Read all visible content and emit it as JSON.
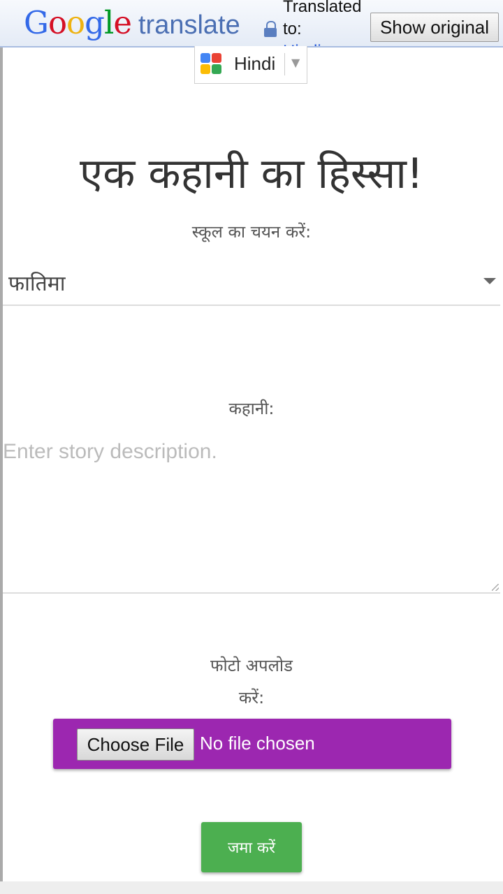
{
  "translate_bar": {
    "logo_google": "Google",
    "logo_word": "translate",
    "translated_line1": "Translated",
    "translated_line2": "to:",
    "translated_lang": "Hindi",
    "show_original_label": "Show original"
  },
  "language_select": {
    "selected": "Hindi"
  },
  "page": {
    "title": "एक कहानी का हिस्सा!",
    "school_label": "स्कूल का चयन करें:",
    "school_selected": "फातिमा",
    "story_label": "कहानी:",
    "story_placeholder": "Enter story description.",
    "photo_label_line1": "फोटो अपलोड",
    "photo_label_line2": "करें:",
    "choose_file_label": "Choose File",
    "no_file_text": "No file chosen",
    "submit_label": "जमा करें"
  },
  "colors": {
    "file_box": "#9c27b0",
    "submit": "#4caf50",
    "translate_bar_border": "#a9bde0"
  }
}
